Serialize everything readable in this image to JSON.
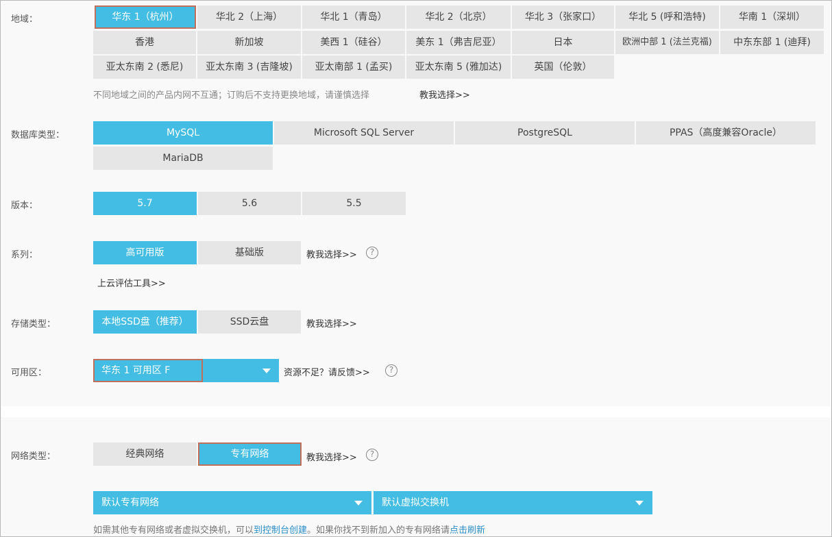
{
  "region": {
    "label": "地域：",
    "options": [
      [
        "华东 1（杭州）",
        "华北 2（上海）",
        "华北 1（青岛）",
        "华北 2（北京）",
        "华北 3（张家口）",
        "华北 5 (呼和浩特)",
        "华南 1（深圳）"
      ],
      [
        "香港",
        "新加坡",
        "美西 1（硅谷）",
        "美东 1（弗吉尼亚）",
        "日本",
        "欧洲中部 1 (法兰克福)",
        "中东东部 1 (迪拜)"
      ],
      [
        "亚太东南 2 (悉尼)",
        "亚太东南 3 (吉隆坡)",
        "亚太南部 1 (孟买)",
        "亚太东南 5 (雅加达)",
        "英国（伦敦）"
      ]
    ],
    "selected": "华东 1（杭州）",
    "hint": "不同地域之间的产品内网不互通；订购后不支持更换地域，请谨慎选择",
    "help_link": "教我选择>>"
  },
  "db_type": {
    "label": "数据库类型：",
    "options": [
      "MySQL",
      "Microsoft SQL Server",
      "PostgreSQL",
      "PPAS（高度兼容Oracle）",
      "MariaDB"
    ],
    "selected": "MySQL"
  },
  "version": {
    "label": "版本：",
    "options": [
      "5.7",
      "5.6",
      "5.5"
    ],
    "selected": "5.7"
  },
  "series": {
    "label": "系列：",
    "options": [
      "高可用版",
      "基础版"
    ],
    "selected": "高可用版",
    "help_link": "教我选择>>",
    "tool_link": "上云评估工具>>"
  },
  "storage": {
    "label": "存储类型：",
    "options": [
      "本地SSD盘（推荐）",
      "SSD云盘"
    ],
    "selected": "本地SSD盘（推荐）",
    "help_link": "教我选择>>"
  },
  "zone": {
    "label": "可用区：",
    "value": "华东 1 可用区 F",
    "feedback_link": "资源不足？请反馈>>"
  },
  "network": {
    "label": "网络类型：",
    "options": [
      "经典网络",
      "专有网络"
    ],
    "selected": "专有网络",
    "help_link": "教我选择>>",
    "vpc_value": "默认专有网络",
    "vswitch_value": "默认虚拟交换机",
    "note_prefix": "如需其他专有网络或者虚拟交换机，可以",
    "note_link1": "到控制台创建",
    "note_middle": "。如果你找不到新加入的专有网络请",
    "note_link2": "点击刷新"
  },
  "colors": {
    "accent": "#43bde3",
    "option_bg": "#e6e6e6",
    "highlight_border": "#c0705a",
    "link_blue": "#2a8fc8"
  },
  "icons": {
    "help": "question-circle-icon",
    "caret": "caret-down-icon"
  }
}
